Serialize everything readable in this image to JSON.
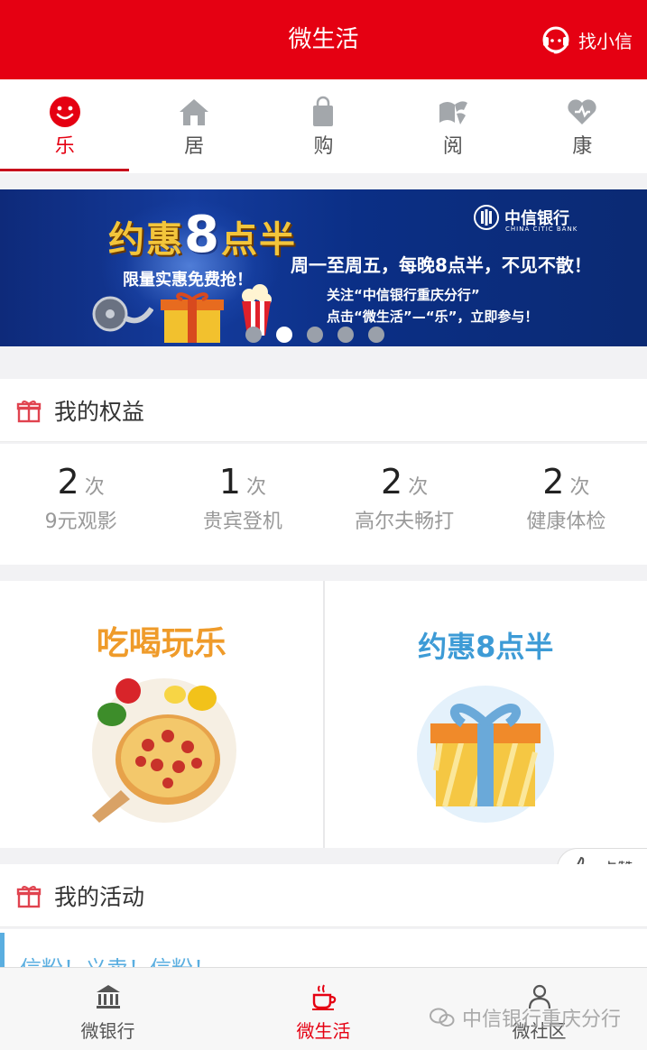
{
  "header": {
    "title": "微生活",
    "help_label": "找小信"
  },
  "tabs": [
    {
      "label": "乐",
      "icon": "smiley-icon",
      "active": true
    },
    {
      "label": "居",
      "icon": "home-icon",
      "active": false
    },
    {
      "label": "购",
      "icon": "shopping-bag-icon",
      "active": false
    },
    {
      "label": "阅",
      "icon": "book-icon",
      "active": false
    },
    {
      "label": "康",
      "icon": "heart-icon",
      "active": false
    }
  ],
  "banner": {
    "title_pre": "约惠",
    "title_num": "8",
    "title_post": "点半",
    "subtitle": "限量实惠免费抢！",
    "bank_name": "中信银行",
    "bank_en": "CHINA CITIC BANK",
    "line1": "周一至周五，每晚8点半，不见不散！",
    "line2": "关注“中信银行重庆分行”",
    "line3": "点击“微生活”—“乐”，立即参与！",
    "slide_count": 5,
    "active_slide": 2
  },
  "benefits": {
    "title": "我的权益",
    "items": [
      {
        "count": "2",
        "unit": "次",
        "label": "9元观影"
      },
      {
        "count": "1",
        "unit": "次",
        "label": "贵宾登机"
      },
      {
        "count": "2",
        "unit": "次",
        "label": "高尔夫畅打"
      },
      {
        "count": "2",
        "unit": "次",
        "label": "健康体检"
      }
    ]
  },
  "cards": [
    {
      "title": "吃喝玩乐",
      "image": "pizza-icon"
    },
    {
      "title": "约惠8点半",
      "image": "gift-box-icon"
    }
  ],
  "like": {
    "label": "点赞"
  },
  "activities": {
    "title": "我的活动",
    "preview": "信粉！义卖！信粉！"
  },
  "bottom_nav": [
    {
      "label": "微银行",
      "icon": "bank-icon",
      "active": false
    },
    {
      "label": "微生活",
      "icon": "coffee-icon",
      "active": true
    },
    {
      "label": "微社区",
      "icon": "community-icon",
      "active": false
    }
  ],
  "watermark": "中信银行重庆分行",
  "colors": {
    "brand_red": "#e50012",
    "accent_orange": "#ef9b2a",
    "accent_blue": "#3d9bd6"
  }
}
